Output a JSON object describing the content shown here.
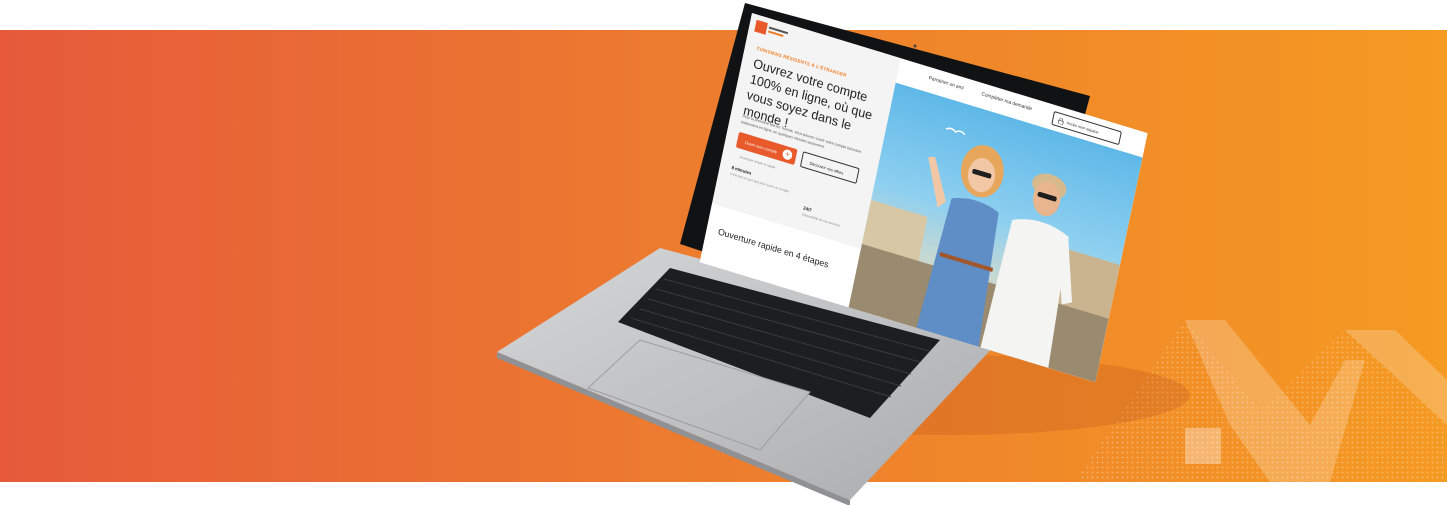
{
  "colors": {
    "banner_left": "#e65a3b",
    "banner_right": "#f59a22",
    "brand_orange": "#e85a2b"
  },
  "screen": {
    "nav": {
      "item_1": "Parrainer un ami",
      "item_2": "Compléter ma demande"
    },
    "top_cta": "Accès mon espace",
    "eyebrow": "TUNISIENS RÉSIDENTS À L'ÉTRANGER",
    "headline": "Ouvrez votre compte 100% en ligne, où que vous soyez dans le monde !",
    "lead": "Pour la première fois en Tunisie, vous pouvez ouvrir votre compte bancaire totalement en ligne, en quelques minutes seulement.",
    "primary_button": "Ouvrir mon compte",
    "secondary_button": "Découvrir nos offres",
    "hint": "Ouverture simple et rapide",
    "stats": [
      {
        "title": "8 minutes",
        "desc": "C'est tout ce qu'il faut pour ouvrir un compte"
      },
      {
        "title": "24/7",
        "desc": "Disponibilité de nos services"
      }
    ],
    "section_title": "Ouverture rapide en 4 étapes"
  }
}
